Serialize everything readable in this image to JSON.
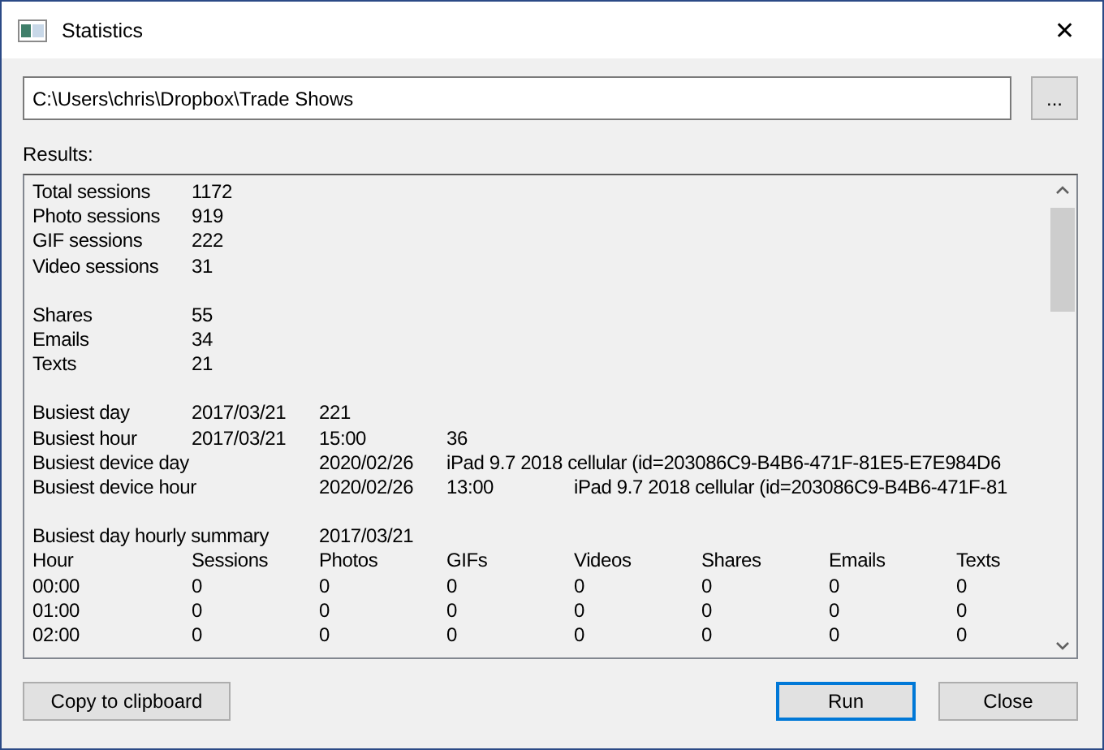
{
  "window": {
    "title": "Statistics",
    "close": "✕"
  },
  "path_field": {
    "value": "C:\\Users\\chris\\Dropbox\\Trade Shows"
  },
  "browse_button": "...",
  "results_label": "Results:",
  "results": [
    {
      "lines": [
        "Total sessions\t1172",
        "Photo sessions\t919",
        "GIF sessions\t222",
        "Video sessions\t31"
      ]
    },
    {
      "lines": [
        "Shares\t55",
        "Emails\t34",
        "Texts\t21"
      ]
    },
    {
      "lines": [
        "Busiest day\t2017/03/21\t221",
        "Busiest hour\t2017/03/21\t15:00\t36",
        "Busiest device day\t2020/02/26\tiPad 9.7 2018 cellular (id=203086C9-B4B6-471F-81E5-E7E984D6",
        "Busiest device hour\t2020/02/26\t13:00\tiPad 9.7 2018 cellular (id=203086C9-B4B6-471F-81"
      ]
    },
    {
      "lines": [
        "Busiest day hourly summary\t2017/03/21",
        "Hour\tSessions\tPhotos\tGIFs\tVideos\tShares\tEmails\tTexts",
        "00:00\t0\t0\t0\t0\t0\t0\t0",
        "01:00\t0\t0\t0\t0\t0\t0\t0",
        "02:00\t0\t0\t0\t0\t0\t0\t0"
      ]
    }
  ],
  "buttons": [
    {
      "label": "Copy to clipboard",
      "default": false
    },
    {
      "label": "Run",
      "default": true
    },
    {
      "label": "Close",
      "default": false
    }
  ]
}
